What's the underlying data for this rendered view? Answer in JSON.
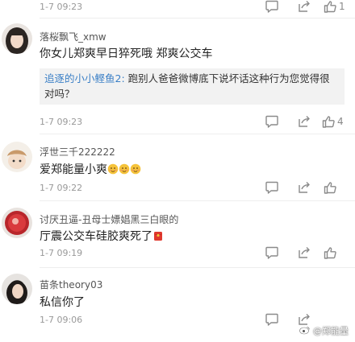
{
  "comments": [
    {
      "username": "",
      "text": "",
      "time": "1-7 09:23",
      "likes": "1"
    },
    {
      "username": "落桜飘飞_xmw",
      "text": "你女儿郑爽早日猝死哦 郑爽公交车",
      "quote_author": "追逐的小小鲣鱼2:",
      "quote_text": "跑别人爸爸微博底下说坏话这种行为您觉得很对吗？",
      "time": "1-7 09:23",
      "likes": "4"
    },
    {
      "username": "浮世三千222222",
      "text": "爱郑能量小爽",
      "time": "1-7 09:22",
      "likes": ""
    },
    {
      "username": "讨厌丑逼-丑母士嫖娼黑三白眼的",
      "text": "厅震公交车硅胶爽死了",
      "time": "1-7 09:19",
      "likes": ""
    },
    {
      "username": "苗条theory03",
      "text": "私信你了",
      "time": "1-7 09:06",
      "likes": ""
    }
  ],
  "icons": {
    "comment": "comment-icon",
    "share": "share-icon",
    "like": "thumbs-up-icon"
  },
  "watermark": "@郑能量",
  "colors": {
    "link_blue": "#3a7fc6",
    "muted_gray": "#999999",
    "quote_bg": "#f2f2f2"
  }
}
